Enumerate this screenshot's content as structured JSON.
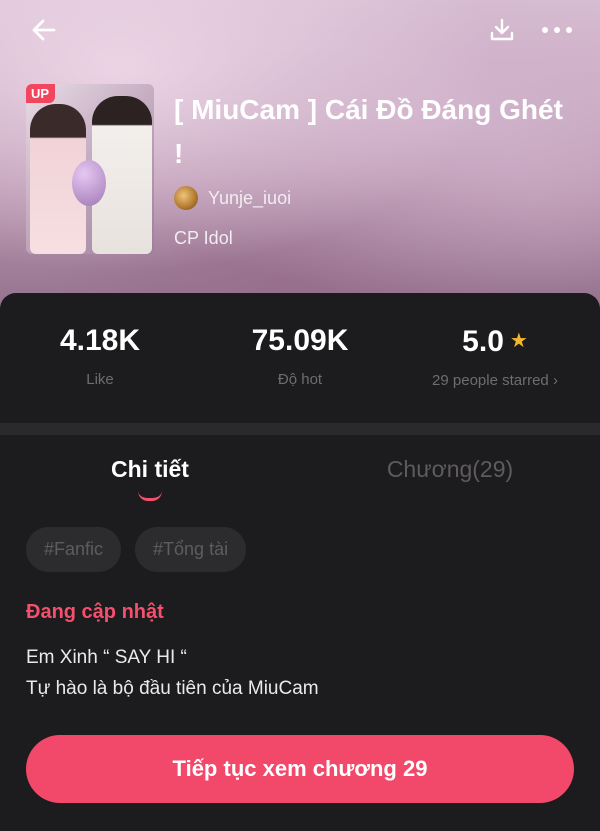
{
  "header": {
    "back_icon": "arrow-left-icon",
    "download_icon": "download-icon",
    "more_icon": "more-dots-icon"
  },
  "story": {
    "badge": "UP",
    "title": "[ MiuCam ] Cái Đồ Đáng Ghét !",
    "author": "Yunje_iuoi",
    "category": "CP Idol"
  },
  "stats": {
    "likes_value": "4.18K",
    "likes_label": "Like",
    "hot_value": "75.09K",
    "hot_label": "Độ hot",
    "rating_value": "5.0",
    "rating_label": "29 people starred",
    "rating_arrow": "›"
  },
  "tabs": [
    {
      "label": "Chi tiết",
      "active": true
    },
    {
      "label": "Chương(29)",
      "active": false
    }
  ],
  "tags": [
    "#Fanfic",
    "#Tổng tài"
  ],
  "status": "Đang cập nhật",
  "description": [
    "Em Xinh “ SAY HI “",
    "Tự hào là bộ đầu tiên của MiuCam"
  ],
  "cta_label": "Tiếp tục xem chương 29",
  "colors": {
    "accent": "#f2496a",
    "star": "#f4b72c",
    "panel": "#1c1b1d"
  }
}
